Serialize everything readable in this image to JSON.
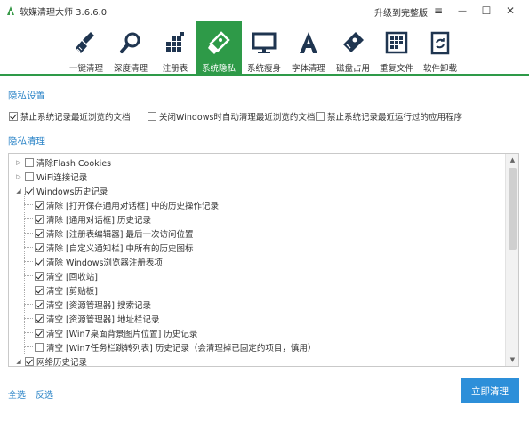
{
  "titlebar": {
    "title": "软媒清理大师 3.6.6.0",
    "upgrade_label": "升级到完整版",
    "menu_glyph": "≡",
    "minimize_glyph": "—",
    "maximize_glyph": "☐",
    "close_glyph": "✕"
  },
  "toolbar": {
    "items": [
      {
        "label": "一键清理",
        "icon": "broom-icon"
      },
      {
        "label": "深度清理",
        "icon": "magnifier-icon"
      },
      {
        "label": "注册表",
        "icon": "registry-blocks-icon"
      },
      {
        "label": "系统隐私",
        "icon": "eraser-icon",
        "active": true
      },
      {
        "label": "系统瘦身",
        "icon": "monitor-icon"
      },
      {
        "label": "字体清理",
        "icon": "font-a-icon"
      },
      {
        "label": "磁盘占用",
        "icon": "disk-usage-icon"
      },
      {
        "label": "重复文件",
        "icon": "duplicate-files-icon"
      },
      {
        "label": "软件卸载",
        "icon": "recycle-bin-icon"
      }
    ],
    "accent_color": "#2e9a48"
  },
  "privacy_settings": {
    "title": "隐私设置",
    "options": [
      {
        "label": "禁止系统记录最近浏览的文档",
        "checked": true
      },
      {
        "label": "关闭Windows时自动清理最近浏览的文档",
        "checked": false
      },
      {
        "label": "禁止系统记录最近运行过的应用程序",
        "checked": false
      }
    ]
  },
  "privacy_clean": {
    "title": "隐私清理",
    "tree": [
      {
        "label": "清除Flash Cookies",
        "checked": false,
        "expander": "▷",
        "level": 0
      },
      {
        "label": "WiFi连接记录",
        "checked": false,
        "expander": "▷",
        "level": 0
      },
      {
        "label": "Windows历史记录",
        "checked": true,
        "expander": "◢",
        "level": 0
      },
      {
        "label": "清除 [打开保存通用对话框] 中的历史操作记录",
        "checked": true,
        "level": 1
      },
      {
        "label": "清除 [通用对话框] 历史记录",
        "checked": true,
        "level": 1
      },
      {
        "label": "清除 [注册表编辑器] 最后一次访问位置",
        "checked": true,
        "level": 1
      },
      {
        "label": "清除 [自定义通知栏] 中所有的历史图标",
        "checked": true,
        "level": 1
      },
      {
        "label": "清除 Windows浏览器注册表项",
        "checked": true,
        "level": 1
      },
      {
        "label": "清空 [回收站]",
        "checked": true,
        "level": 1
      },
      {
        "label": "清空 [剪贴板]",
        "checked": true,
        "level": 1
      },
      {
        "label": "清空 [资源管理器] 搜索记录",
        "checked": true,
        "level": 1
      },
      {
        "label": "清空 [资源管理器] 地址栏记录",
        "checked": true,
        "level": 1
      },
      {
        "label": "清空 [Win7桌面背景图片位置] 历史记录",
        "checked": true,
        "level": 1
      },
      {
        "label": "清空 [Win7任务栏跳转列表] 历史记录（会清理掉已固定的项目，慎用）",
        "checked": false,
        "level": 1
      },
      {
        "label": "网络历史记录",
        "checked": true,
        "expander": "◢",
        "level": 0
      }
    ]
  },
  "scrollbar": {
    "up_glyph": "▲",
    "down_glyph": "▼"
  },
  "footer": {
    "select_all": "全选",
    "invert": "反选",
    "clean_button": "立即清理",
    "button_color": "#2d8fd9"
  }
}
